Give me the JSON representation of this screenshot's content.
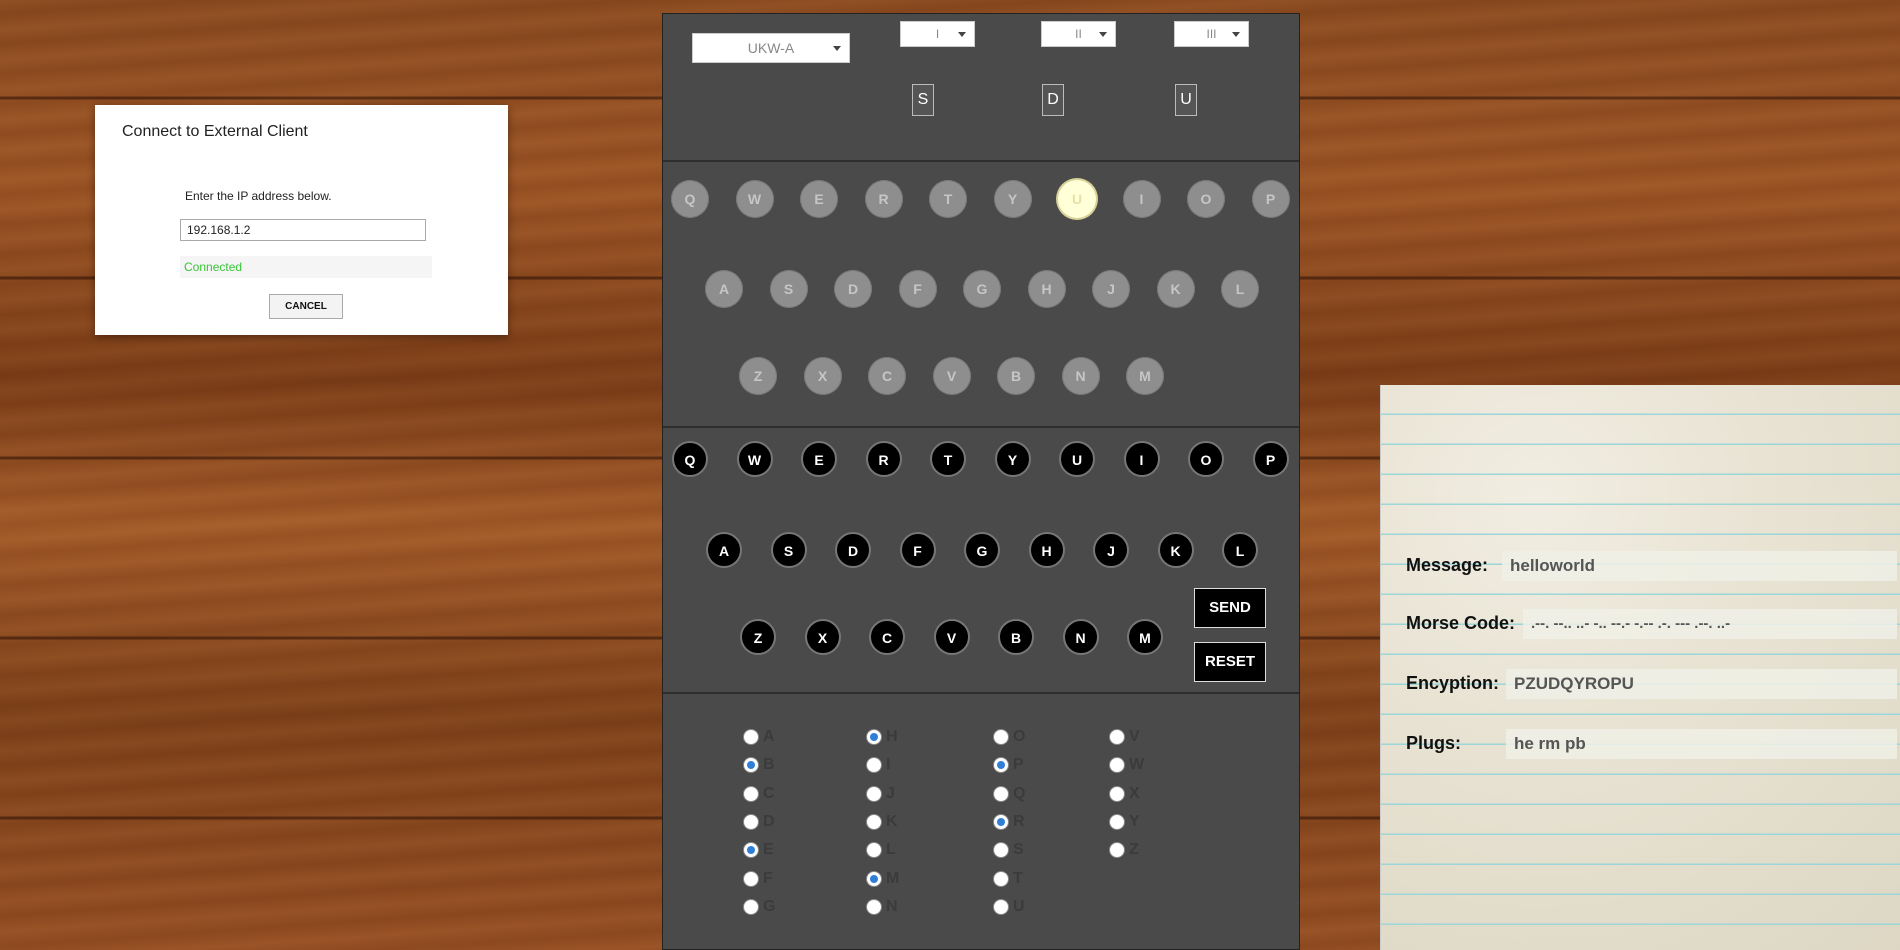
{
  "dialog": {
    "title": "Connect to External Client",
    "prompt": "Enter the IP address below.",
    "ip_value": "192.168.1.2",
    "status": "Connected",
    "cancel_label": "CANCEL"
  },
  "machine": {
    "reflector": "UKW-A",
    "rotors": [
      {
        "label": "I",
        "position": "S"
      },
      {
        "label": "II",
        "position": "D"
      },
      {
        "label": "III",
        "position": "U"
      }
    ],
    "lampboard": {
      "rows": [
        [
          "Q",
          "W",
          "E",
          "R",
          "T",
          "Y",
          "U",
          "I",
          "O",
          "P"
        ],
        [
          "A",
          "S",
          "D",
          "F",
          "G",
          "H",
          "J",
          "K",
          "L"
        ],
        [
          "Z",
          "X",
          "C",
          "V",
          "B",
          "N",
          "M"
        ]
      ],
      "lit": "U"
    },
    "keyboard": {
      "rows": [
        [
          "Q",
          "W",
          "E",
          "R",
          "T",
          "Y",
          "U",
          "I",
          "O",
          "P"
        ],
        [
          "A",
          "S",
          "D",
          "F",
          "G",
          "H",
          "J",
          "K",
          "L"
        ],
        [
          "Z",
          "X",
          "C",
          "V",
          "B",
          "N",
          "M"
        ]
      ]
    },
    "send_label": "SEND",
    "reset_label": "RESET",
    "plugboard": {
      "columns": [
        [
          "A",
          "B",
          "C",
          "D",
          "E",
          "F",
          "G"
        ],
        [
          "H",
          "I",
          "J",
          "K",
          "L",
          "M",
          "N"
        ],
        [
          "O",
          "P",
          "Q",
          "R",
          "S",
          "T",
          "U"
        ],
        [
          "V",
          "W",
          "X",
          "Y",
          "Z"
        ]
      ],
      "selected": [
        "B",
        "E",
        "H",
        "M",
        "P",
        "R"
      ]
    }
  },
  "notepad": {
    "message_label": "Message:",
    "message_value": "helloworld",
    "morse_label": "Morse Code:",
    "morse_value": ".--.  --..  ..-  -..  --.-  -.--  .-.  ---  .--.  ..-",
    "encryption_label": "Encyption:",
    "encryption_value": "PZUDQYROPU",
    "plugs_label": "Plugs:",
    "plugs_value": "he rm pb"
  },
  "colors": {
    "panel": "#4a4a4a",
    "lamp_off": "#8e8e8e",
    "lamp_lit": "#ffffd8",
    "key": "#000000",
    "status_green": "#3ac43a",
    "radio_on": "#2f7fd6"
  }
}
